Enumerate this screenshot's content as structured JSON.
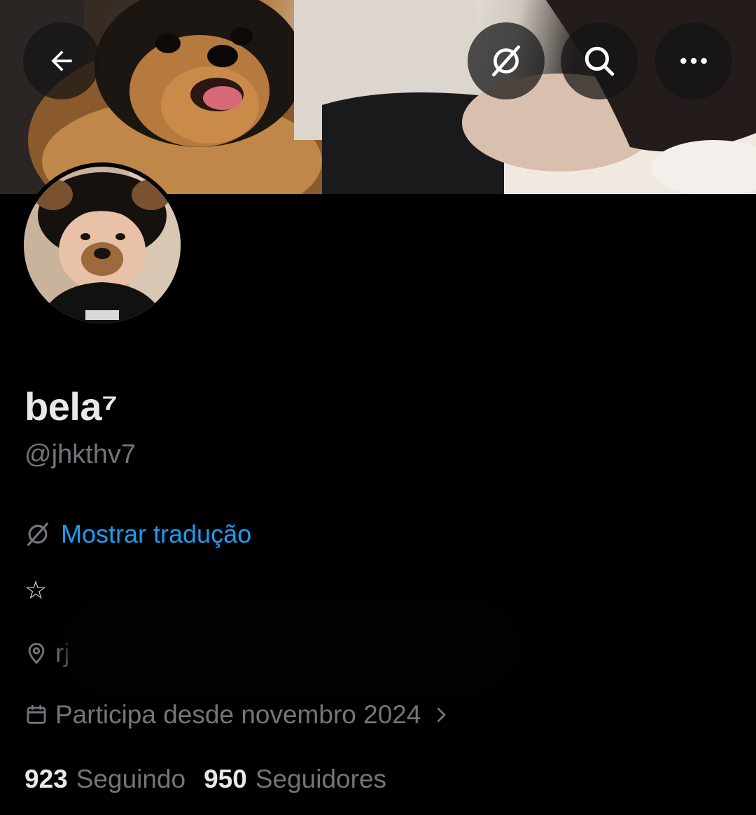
{
  "header": {
    "back_label": "Voltar",
    "translate_icon": "translate-icon",
    "search_icon": "search-icon",
    "more_icon": "more-icon"
  },
  "banner": {
    "description_icon": "banner-image"
  },
  "profile": {
    "display_name": "bela⁷",
    "handle": "@jhkthv7",
    "translate_label": "Mostrar tradução",
    "bio": "☆",
    "location": "rj",
    "joined": "Participa desde novembro 2024",
    "following_count": "923",
    "following_label": "Seguindo",
    "followers_count": "950",
    "followers_label": "Seguidores"
  },
  "colors": {
    "background": "#000000",
    "primary_text": "#e7e9ea",
    "secondary_text": "#71767b",
    "accent": "#1d9bf0"
  }
}
